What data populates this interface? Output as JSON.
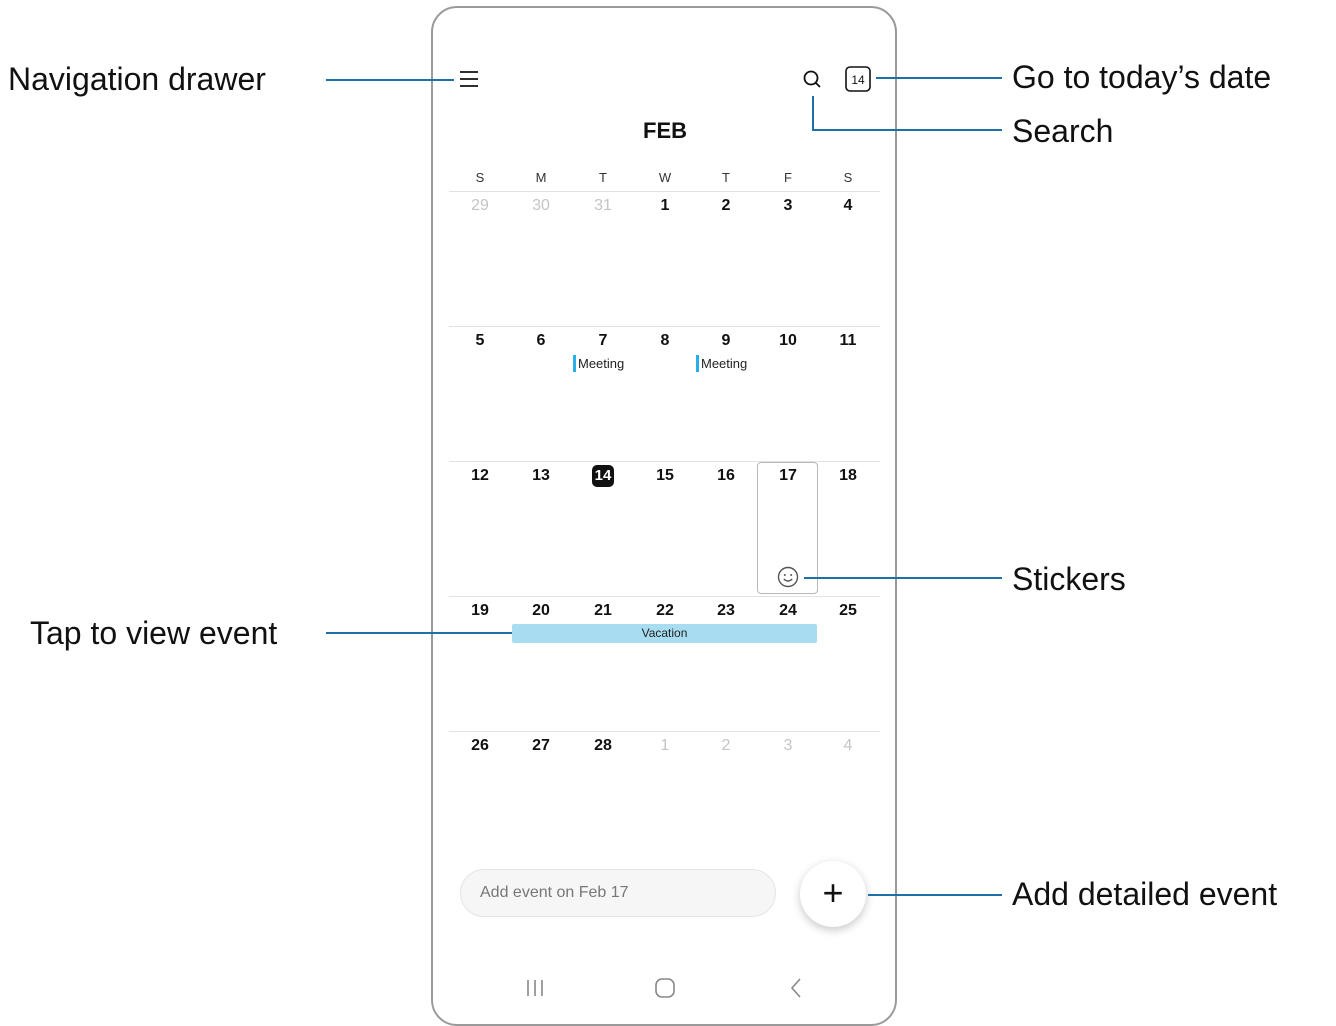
{
  "calendar": {
    "month": "FEB",
    "weekdays": [
      "S",
      "M",
      "T",
      "W",
      "T",
      "F",
      "S"
    ],
    "weeks": [
      [
        "29",
        "30",
        "31",
        "1",
        "2",
        "3",
        "4"
      ],
      [
        "5",
        "6",
        "7",
        "8",
        "9",
        "10",
        "11"
      ],
      [
        "12",
        "13",
        "14",
        "15",
        "16",
        "17",
        "18"
      ],
      [
        "19",
        "20",
        "21",
        "22",
        "23",
        "24",
        "25"
      ],
      [
        "26",
        "27",
        "28",
        "1",
        "2",
        "3",
        "4"
      ]
    ],
    "today": "14",
    "events": {
      "meeting_1": "Meeting",
      "meeting_2": "Meeting",
      "vacation": "Vacation"
    }
  },
  "toolbar": {
    "menu_icon": "hamburger-menu-icon",
    "search_icon": "search-icon",
    "today_icon_label": "14"
  },
  "bottom": {
    "add_event_placeholder": "Add event on Feb 17",
    "fab_label": "+"
  },
  "callouts": {
    "navigation_drawer": "Navigation drawer",
    "today": "Go to today’s date",
    "search": "Search",
    "stickers": "Stickers",
    "tap_event": "Tap to view event",
    "add_detailed": "Add detailed event"
  },
  "colors": {
    "callout_line": "#1f6fa8",
    "meeting_bar": "#2ab0e8",
    "vacation_bar": "#a8dcf1"
  }
}
